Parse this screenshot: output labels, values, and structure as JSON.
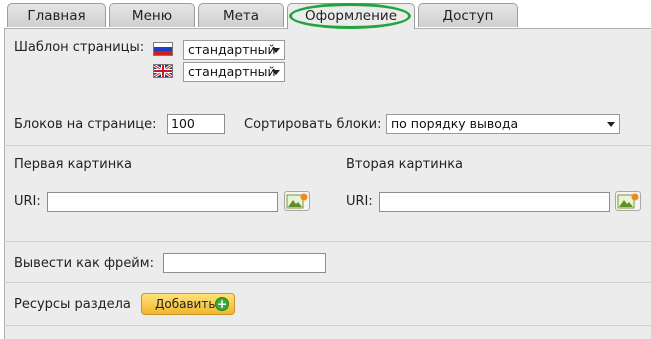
{
  "tabs": [
    {
      "label": "Главная"
    },
    {
      "label": "Меню"
    },
    {
      "label": "Мета"
    },
    {
      "label": "Оформление"
    },
    {
      "label": "Доступ"
    }
  ],
  "active_tab": "Оформление",
  "template": {
    "label": "Шаблон страницы:",
    "ru_value": "стандартный",
    "en_value": "стандартный"
  },
  "blocks": {
    "per_page_label": "Блоков на странице:",
    "per_page_value": "100",
    "sort_label": "Сортировать блоки:",
    "sort_value": "по порядку вывода"
  },
  "first_image": {
    "title": "Первая картинка",
    "uri_label": "URI:",
    "uri_value": ""
  },
  "second_image": {
    "title": "Вторая картинка",
    "uri_label": "URI:",
    "uri_value": ""
  },
  "frame": {
    "label": "Вывести как фрейм:",
    "value": ""
  },
  "resources": {
    "label": "Ресурсы раздела",
    "add_label": "Добавить"
  },
  "colors": {
    "highlight_ring": "#22a53c",
    "add_button": "#f1b72c",
    "panel_bg": "#ececec"
  }
}
